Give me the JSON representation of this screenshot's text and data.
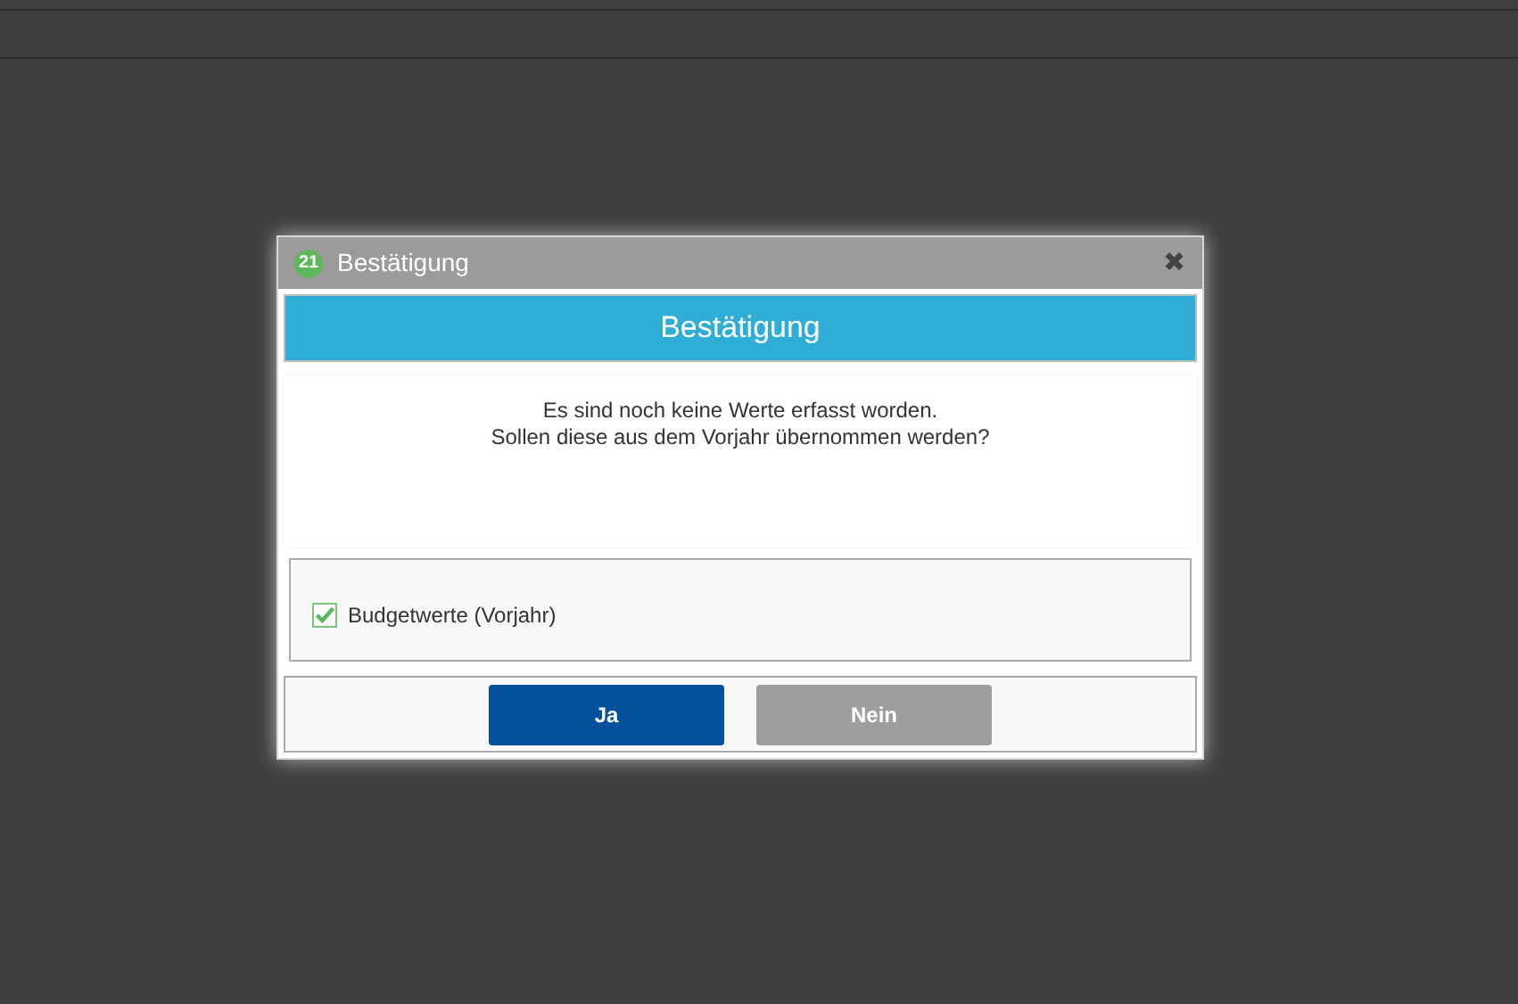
{
  "dialog": {
    "badge": "21",
    "title": "Bestätigung",
    "close": "✖"
  },
  "header": "Bestätigung",
  "message": [
    "Es sind noch keine Werte erfasst worden.",
    "Sollen diese aus dem Vorjahr übernommen werden?"
  ],
  "options": [
    {
      "label": "Budgetwerte (Vorjahr)",
      "checked": true
    }
  ],
  "buttons": [
    {
      "label": "Ja",
      "kind": "primary"
    },
    {
      "label": "Nein",
      "kind": "secondary"
    }
  ]
}
